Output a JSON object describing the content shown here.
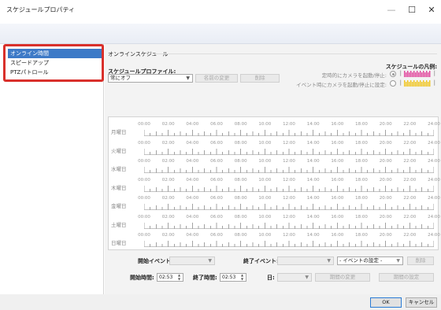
{
  "window": {
    "title": "スケジュールプロパティ",
    "minimize": "—",
    "maximize": "☐",
    "close": "✕"
  },
  "sidebar": {
    "items": [
      {
        "label": "オンライン時間",
        "active": true
      },
      {
        "label": "スピードアップ",
        "active": false
      },
      {
        "label": "PTZパトロール",
        "active": false
      }
    ]
  },
  "main": {
    "section_title": "オンラインスケジュール",
    "profile_label": "スケジュールプロファイル:",
    "profile_value": "常にオフ",
    "rename_button": "名前の変更",
    "delete_button": "削除",
    "legend_title": "スケジュールの凡例:",
    "legend_scheduled": "定時的にカメラを起動/停止:",
    "legend_event": "イベント時にカメラを起動/停止に設定:",
    "legend_colors": {
      "scheduled": "#e0409a",
      "event": "#f0c419"
    }
  },
  "schedule": {
    "days": [
      "月曜日",
      "火曜日",
      "水曜日",
      "木曜日",
      "金曜日",
      "土曜日",
      "日曜日"
    ],
    "hour_labels": [
      "00:00",
      "02:00",
      "04:00",
      "06:00",
      "08:00",
      "10:00",
      "12:00",
      "14:00",
      "16:00",
      "18:00",
      "20:00",
      "22:00",
      "24:00"
    ]
  },
  "controls": {
    "start_event_label": "開始イベント:",
    "end_event_label": "終了イベント:",
    "event_settings_value": "- イベントの設定 -",
    "delete_button": "削除",
    "start_time_label": "開始時間:",
    "start_time_value": "02:53",
    "end_time_label": "終了時間:",
    "end_time_value": "02:53",
    "day_label": "日:",
    "change_period_button": "期間の変更",
    "set_period_button": "期間の設定"
  },
  "footer": {
    "ok": "OK",
    "cancel": "キャンセル"
  }
}
